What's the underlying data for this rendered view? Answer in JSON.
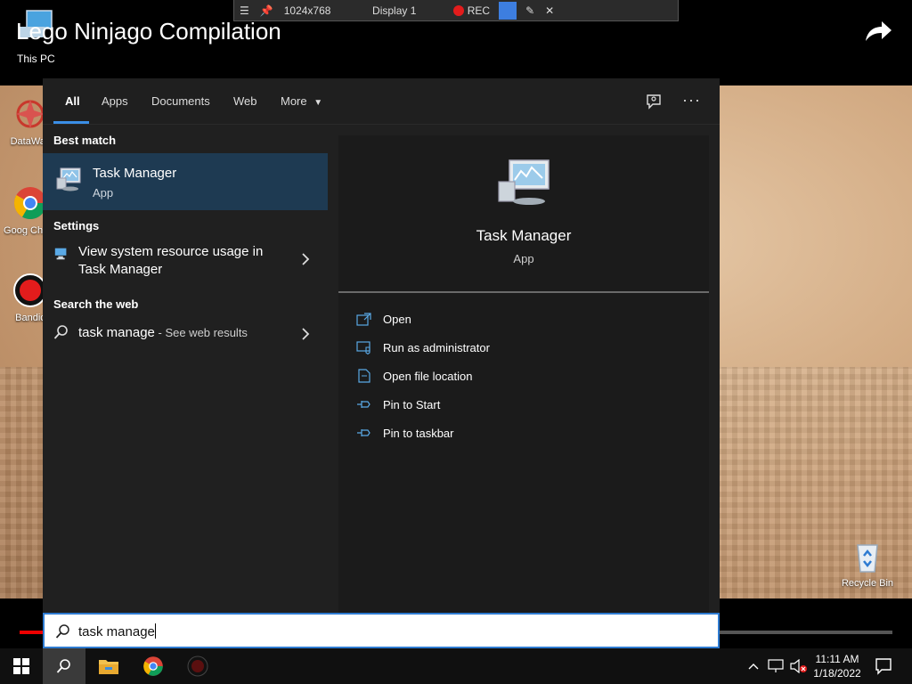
{
  "video": {
    "title": "Lego Ninjago Compilation",
    "subtitle": "This PC",
    "progress": 0.03
  },
  "recorder": {
    "resolution": "1024x768",
    "display": "Display 1",
    "rec_label": "REC"
  },
  "desktop_icons": [
    {
      "label": "DataWac",
      "icon": "datawac-icon"
    },
    {
      "label": "Goog Chron",
      "icon": "chrome-icon"
    },
    {
      "label": "Bandic",
      "icon": "bandicam-icon"
    },
    {
      "label": "Recycle Bin",
      "icon": "recycle-bin-icon"
    }
  ],
  "search": {
    "tabs": [
      "All",
      "Apps",
      "Documents",
      "Web",
      "More"
    ],
    "active_tab": "All",
    "best_match_heading": "Best match",
    "best_match": {
      "name": "Task Manager",
      "type": "App"
    },
    "settings_heading": "Settings",
    "settings_item_line1": "View system resource usage in",
    "settings_item_line2": "Task Manager",
    "web_heading": "Search the web",
    "web_query": "task manage",
    "web_suffix": " - See web results",
    "detail": {
      "name": "Task Manager",
      "type": "App",
      "actions": [
        "Open",
        "Run as administrator",
        "Open file location",
        "Pin to Start",
        "Pin to taskbar"
      ]
    },
    "query": "task manage"
  },
  "taskbar": {
    "time": "11:11 AM",
    "date": "1/18/2022"
  },
  "colors": {
    "accent": "#2e7bd1",
    "selected_row": "#1e3a52",
    "panel_bg": "#202020"
  }
}
